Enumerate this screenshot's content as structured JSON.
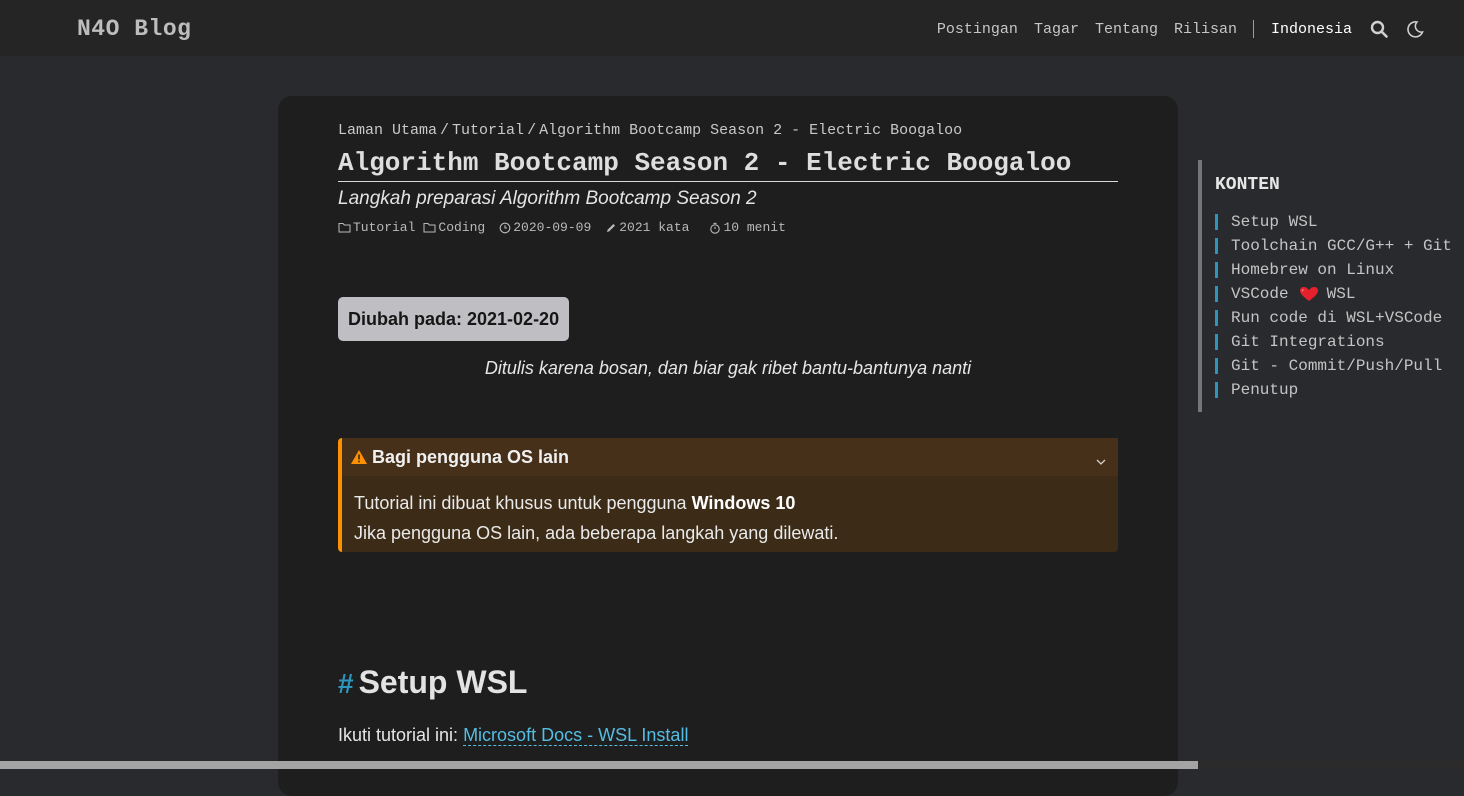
{
  "header": {
    "brand": "N4O Blog",
    "nav": [
      "Postingan",
      "Tagar",
      "Tentang",
      "Rilisan"
    ],
    "language": "Indonesia",
    "icons": [
      "search-icon",
      "moon-icon"
    ]
  },
  "breadcrumb": [
    "Laman Utama",
    "Tutorial",
    "Algorithm Bootcamp Season 2 - Electric Boogaloo"
  ],
  "post": {
    "title": "Algorithm Bootcamp Season 2 - Electric Boogaloo",
    "subtitle": "Langkah preparasi Algorithm Bootcamp Season 2",
    "categories": [
      "Tutorial",
      "Coding"
    ],
    "date": "2020-09-09",
    "word_count": "2021 kata",
    "read_time": "10 menit",
    "updated_badge": "Diubah pada: 2021-02-20",
    "quote": "Ditulis karena bosan, dan biar gak ribet bantu-bantunya nanti"
  },
  "admonition": {
    "title": "Bagi pengguna OS lain",
    "line1_prefix": "Tutorial ini dibuat khusus untuk pengguna ",
    "line1_bold": "Windows 10",
    "line2": "Jika pengguna OS lain, ada beberapa langkah yang dilewati.",
    "accent": "#ff9100"
  },
  "section": {
    "hash": "#",
    "heading": "Setup WSL",
    "text": "Ikuti tutorial ini: ",
    "link": "Microsoft Docs - WSL Install"
  },
  "toc": {
    "title": "KONTEN",
    "items": [
      "Setup WSL",
      "Toolchain GCC/G++ + Git",
      "Homebrew on Linux",
      "VSCode",
      "Run code di WSL+VSCode",
      "Git Integrations",
      "Git - Commit/Push/Pull",
      "Penutup"
    ],
    "vscode_suffix": "WSL",
    "accent": "#2d96bd"
  }
}
